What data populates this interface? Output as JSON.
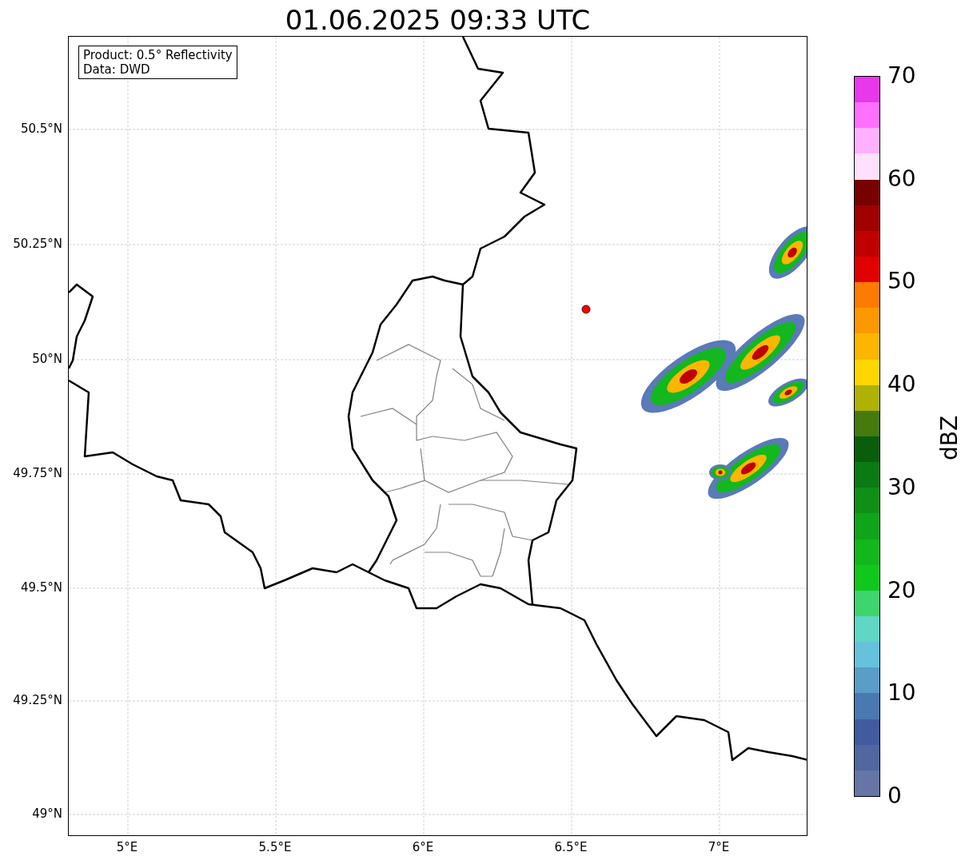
{
  "title": "01.06.2025 09:33 UTC",
  "info_box": {
    "lines": [
      "Product: 0.5° Reflectivity",
      "Data: DWD"
    ]
  },
  "map": {
    "x_ticks": [
      "5°E",
      "5.5°E",
      "6°E",
      "6.5°E",
      "7°E"
    ],
    "y_ticks": [
      "50.5°N",
      "50.25°N",
      "50°N",
      "49.75°N",
      "49.5°N",
      "49.25°N",
      "49°N"
    ]
  },
  "colorbar": {
    "label": "dBZ",
    "ticks": [
      "70",
      "60",
      "50",
      "40",
      "30",
      "20",
      "10",
      "0"
    ],
    "bins": [
      {
        "color": "#6475a6"
      },
      {
        "color": "#52679f"
      },
      {
        "color": "#425b9e"
      },
      {
        "color": "#4a78b0"
      },
      {
        "color": "#5a9dc7"
      },
      {
        "color": "#66c1dc"
      },
      {
        "color": "#60d6c4"
      },
      {
        "color": "#3ed46e"
      },
      {
        "color": "#10c81c"
      },
      {
        "color": "#10b81b"
      },
      {
        "color": "#0fa51a"
      },
      {
        "color": "#0e9016"
      },
      {
        "color": "#0b7a13"
      },
      {
        "color": "#095e0c"
      },
      {
        "color": "#467a0c"
      },
      {
        "color": "#adb204"
      },
      {
        "color": "#fed600"
      },
      {
        "color": "#fdb600"
      },
      {
        "color": "#fd9800"
      },
      {
        "color": "#fd7b00"
      },
      {
        "color": "#e00000"
      },
      {
        "color": "#c00000"
      },
      {
        "color": "#a00000"
      },
      {
        "color": "#780000"
      },
      {
        "color": "#ffe0ff"
      },
      {
        "color": "#ffb0ff"
      },
      {
        "color": "#ff70ff"
      },
      {
        "color": "#e838ec"
      }
    ]
  }
}
